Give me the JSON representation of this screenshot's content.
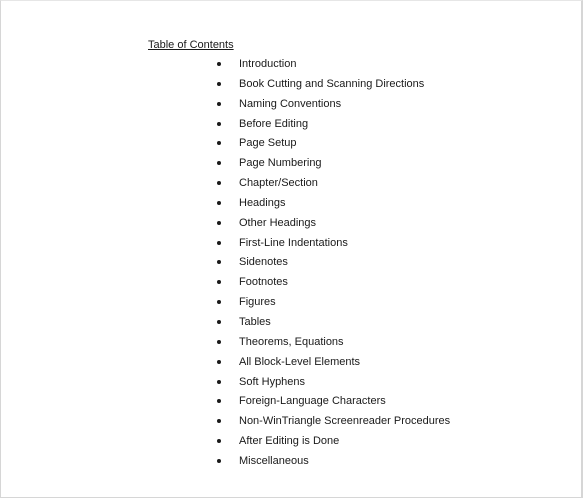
{
  "document": {
    "title": "Table of Contents",
    "items": [
      "Introduction",
      "Book Cutting and Scanning Directions",
      "Naming Conventions",
      "Before Editing",
      "Page Setup",
      "Page Numbering",
      "Chapter/Section",
      "Headings",
      "Other Headings",
      "First-Line Indentations",
      "Sidenotes",
      "Footnotes",
      "Figures",
      "Tables",
      "Theorems, Equations",
      "All Block-Level Elements",
      "Soft Hyphens",
      "Foreign-Language Characters",
      "Non-WinTriangle Screenreader Procedures",
      "After Editing is Done",
      "Miscellaneous"
    ]
  }
}
